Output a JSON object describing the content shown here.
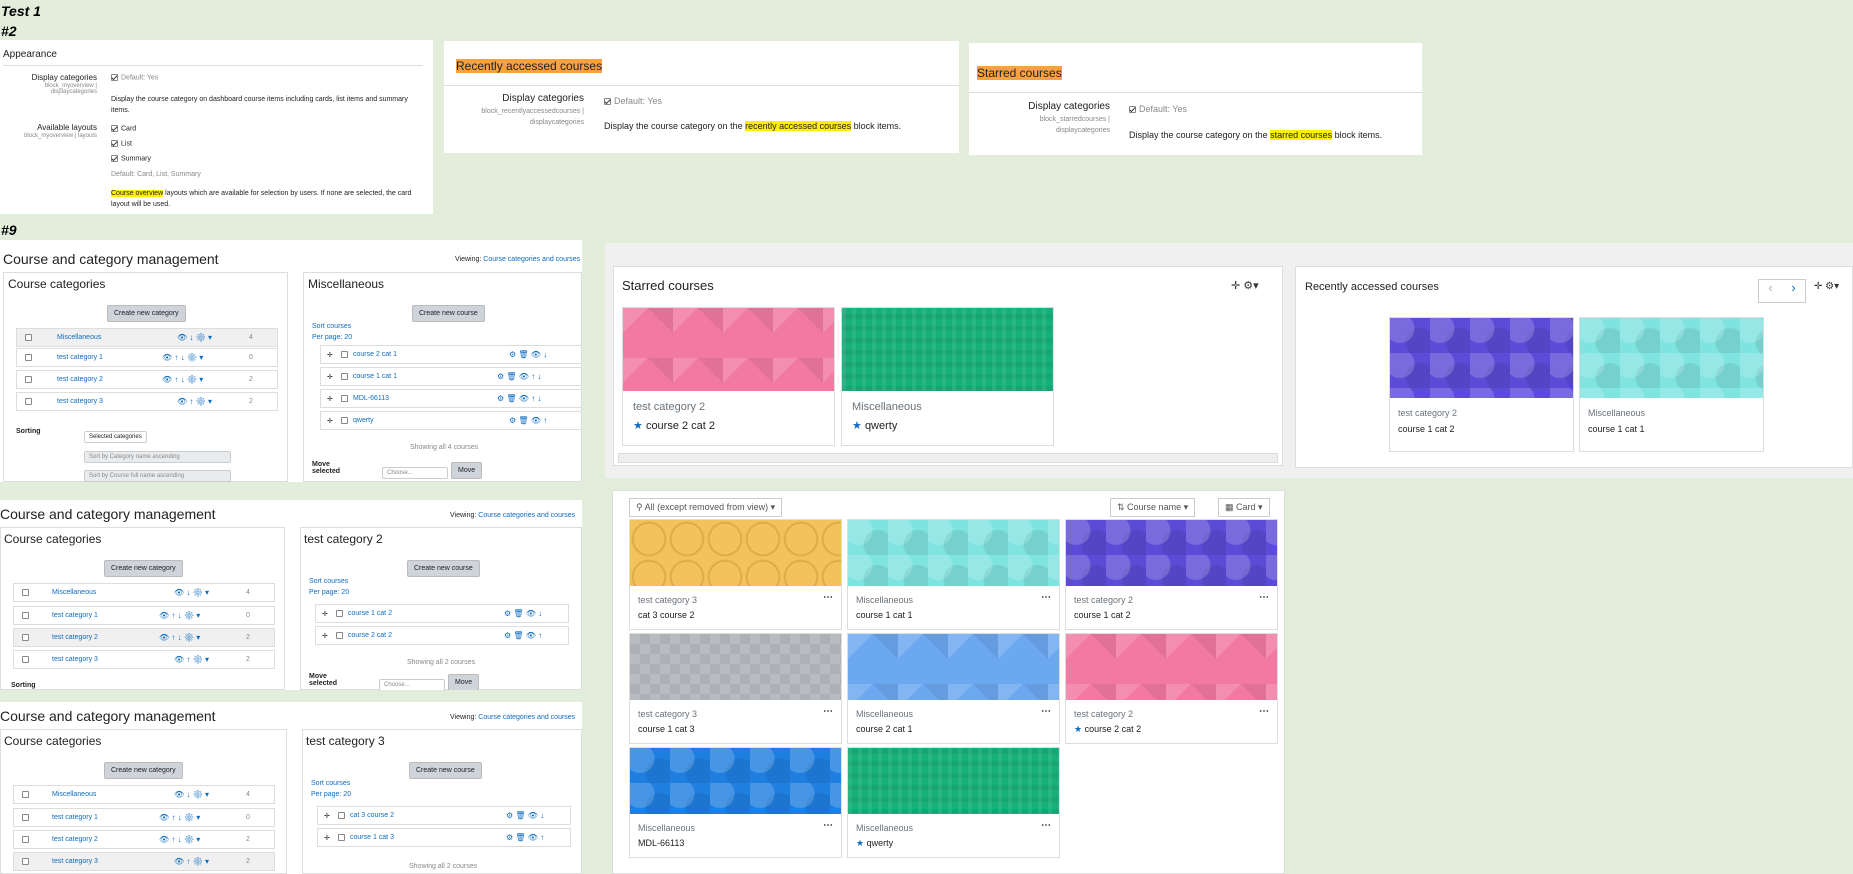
{
  "labels": {
    "test1": "Test 1",
    "n2": "#2",
    "n9": "#9"
  },
  "appearance": {
    "heading": "Appearance",
    "display_categories": {
      "label": "Display categories",
      "key": "block_myoverview | displaycategories",
      "default": "Default: Yes",
      "desc": "Display the course category on dashboard course items including cards, list items and summary items."
    },
    "available_layouts": {
      "label": "Available layouts",
      "key": "block_myoverview | layouts",
      "options": [
        "Card",
        "List",
        "Summary"
      ],
      "default": "Default: Card, List, Summary",
      "desc_hl": "Course overview",
      "desc": " layouts which are available for selection by users. If none are selected, the card layout will be used."
    }
  },
  "recent_settings": {
    "title": "Recently accessed courses",
    "label": "Display categories",
    "key": "block_recentlyaccessedcourses | displaycategories",
    "default": "Default: Yes",
    "desc_pre": "Display the course category on the ",
    "desc_hl": "recently accessed courses",
    "desc_post": " block items."
  },
  "starred_settings": {
    "title": "Starred courses",
    "label": "Display categories",
    "key": "block_starredcourses | displaycategories",
    "default": "Default: Yes",
    "desc_pre": "Display the course category on the ",
    "desc_hl": "starred courses",
    "desc_post": " block items."
  },
  "mgmt": {
    "title": "Course and category management",
    "viewing_label": "Viewing:",
    "viewing_value": "Course categories and courses",
    "categories_heading": "Course categories",
    "create_category": "Create new category",
    "create_course": "Create new course",
    "categories": [
      {
        "name": "Miscellaneous",
        "count": "4"
      },
      {
        "name": "test category 1",
        "count": "0"
      },
      {
        "name": "test category 2",
        "count": "2"
      },
      {
        "name": "test category 3",
        "count": "2"
      }
    ],
    "sorting": "Sorting",
    "sort_sel": "Selected categories",
    "sort_opt1": "Sort by Category name ascending",
    "sort_opt2": "Sort by Course full name ascending",
    "sort_courses": "Sort courses",
    "per_page": "Per page: 20",
    "move_label": "Move selected",
    "choose": "Choose...",
    "move": "Move",
    "p1": {
      "heading": "Miscellaneous",
      "courses": [
        "course 2 cat 1",
        "course 1 cat 1",
        "MDL-66113",
        "qwerty"
      ],
      "showing": "Showing all 4 courses"
    },
    "p2": {
      "heading": "test category 2",
      "courses": [
        "course 1 cat 2",
        "course 2 cat 2"
      ],
      "showing": "Showing all 2 courses"
    },
    "p3": {
      "heading": "test category 3",
      "courses": [
        "cat 3 course 2",
        "course 1 cat 3"
      ],
      "showing": "Showing all 2 courses"
    }
  },
  "starred_block": {
    "title": "Starred courses",
    "cards": [
      {
        "cat": "test category 2",
        "name": "course 2 cat 2",
        "color": "#f27aa2"
      },
      {
        "cat": "Miscellaneous",
        "name": "qwerty",
        "color": "#16b07a"
      }
    ]
  },
  "recent_block": {
    "title": "Recently accessed courses",
    "cards": [
      {
        "cat": "test category 2",
        "name": "course 1 cat 2",
        "color": "#5b4bd6"
      },
      {
        "cat": "Miscellaneous",
        "name": "course 1 cat 1",
        "color": "#7fe3e0"
      }
    ]
  },
  "overview": {
    "filter": "All (except removed from view)",
    "sort": "Course name",
    "view": "Card",
    "cards": [
      {
        "cat": "test category 3",
        "name": "cat 3 course 2",
        "color": "#f5c15a",
        "pattern": "circles",
        "starred": false
      },
      {
        "cat": "Miscellaneous",
        "name": "course 1 cat 1",
        "color": "#7fe3e0",
        "pattern": "hexpat",
        "starred": false
      },
      {
        "cat": "test category 2",
        "name": "course 1 cat 2",
        "color": "#5b4bd6",
        "pattern": "hexpat",
        "starred": false
      },
      {
        "cat": "test category 3",
        "name": "course 1 cat 3",
        "color": "#b8bcc0",
        "pattern": "checker",
        "starred": false
      },
      {
        "cat": "Miscellaneous",
        "name": "course 2 cat 1",
        "color": "#6ca8f0",
        "pattern": "tri",
        "starred": false
      },
      {
        "cat": "test category 2",
        "name": "course 2 cat 2",
        "color": "#f27aa2",
        "pattern": "tri",
        "starred": true
      },
      {
        "cat": "Miscellaneous",
        "name": "MDL-66113",
        "color": "#1e7fe0",
        "pattern": "hexpat",
        "starred": false
      },
      {
        "cat": "Miscellaneous",
        "name": "qwerty",
        "color": "#16b07a",
        "pattern": "stripes",
        "starred": true
      }
    ]
  }
}
